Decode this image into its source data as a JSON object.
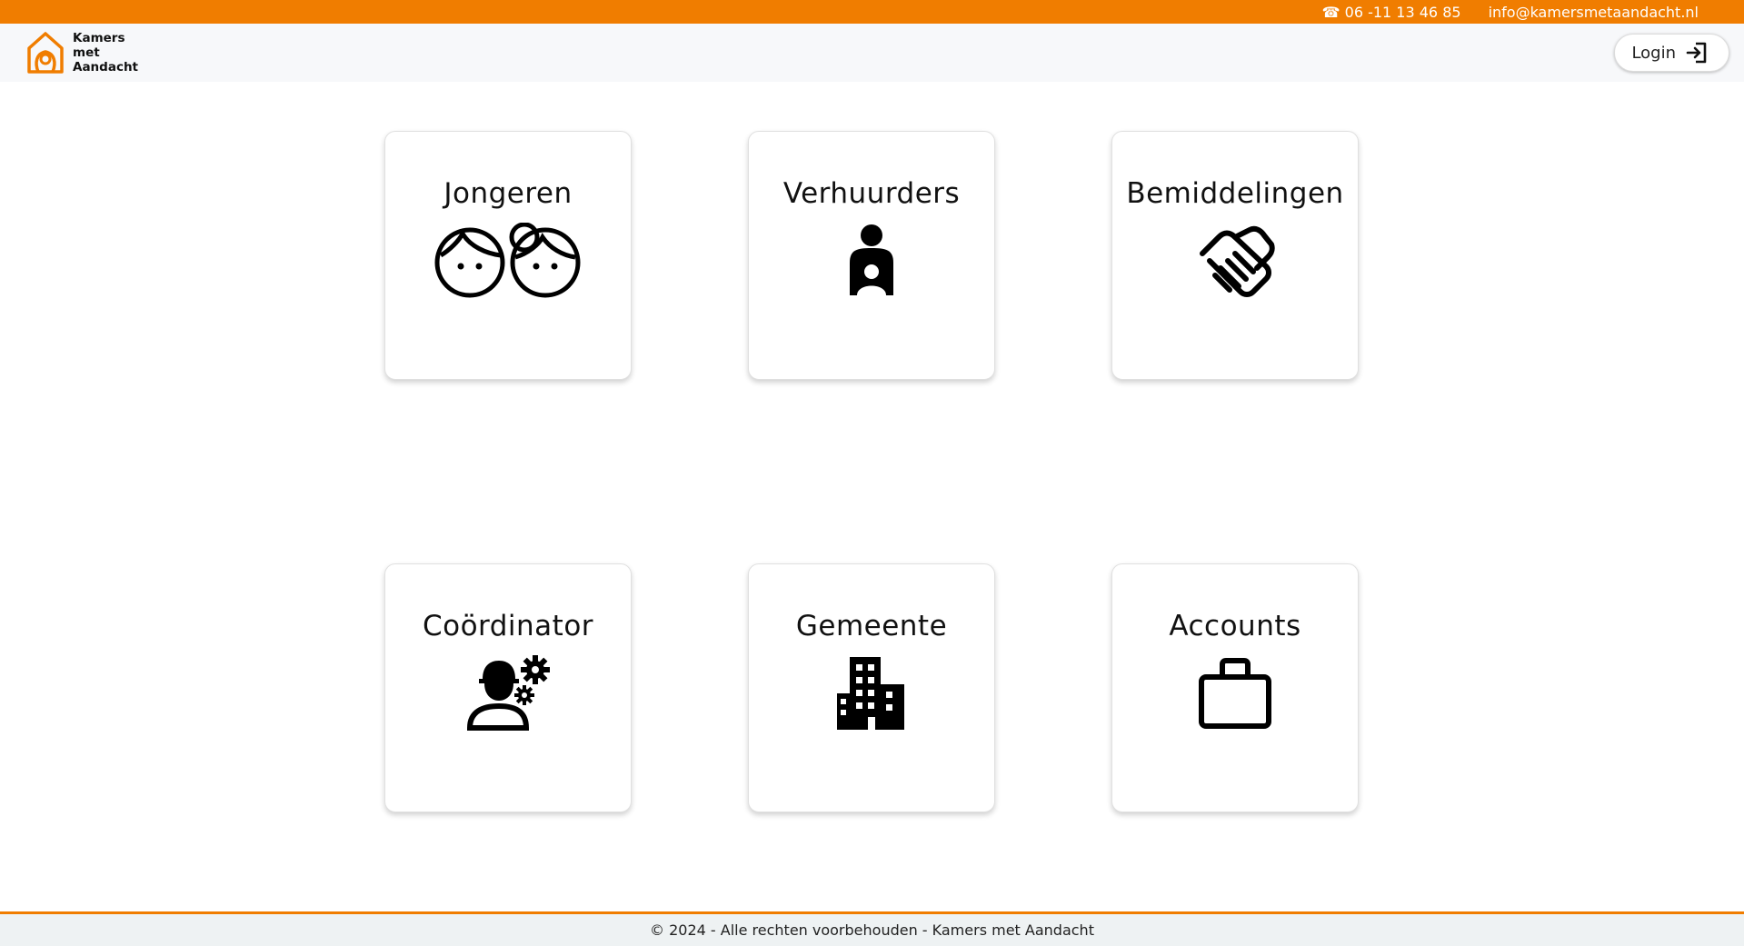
{
  "topbar": {
    "phone": "☎ 06 -11 13 46 85",
    "email": "info@kamersmetaandacht.nl"
  },
  "brand": {
    "line1": "Kamers",
    "line2": "met",
    "line3": "Aandacht",
    "accent_color": "#f07d00"
  },
  "header": {
    "login_label": "Login",
    "login_icon": "login-arrow-icon"
  },
  "cards": [
    {
      "title": "Jongeren",
      "icon": "two-kids-faces-icon"
    },
    {
      "title": "Verhuurders",
      "icon": "landlord-person-icon"
    },
    {
      "title": "Bemiddelingen",
      "icon": "handshake-icon"
    },
    {
      "title": "Coördinator",
      "icon": "worker-gears-icon"
    },
    {
      "title": "Gemeente",
      "icon": "building-icon"
    },
    {
      "title": "Accounts",
      "icon": "briefcase-icon"
    }
  ],
  "footer": {
    "text": "© 2024 - Alle rechten voorbehouden - Kamers met Aandacht"
  }
}
